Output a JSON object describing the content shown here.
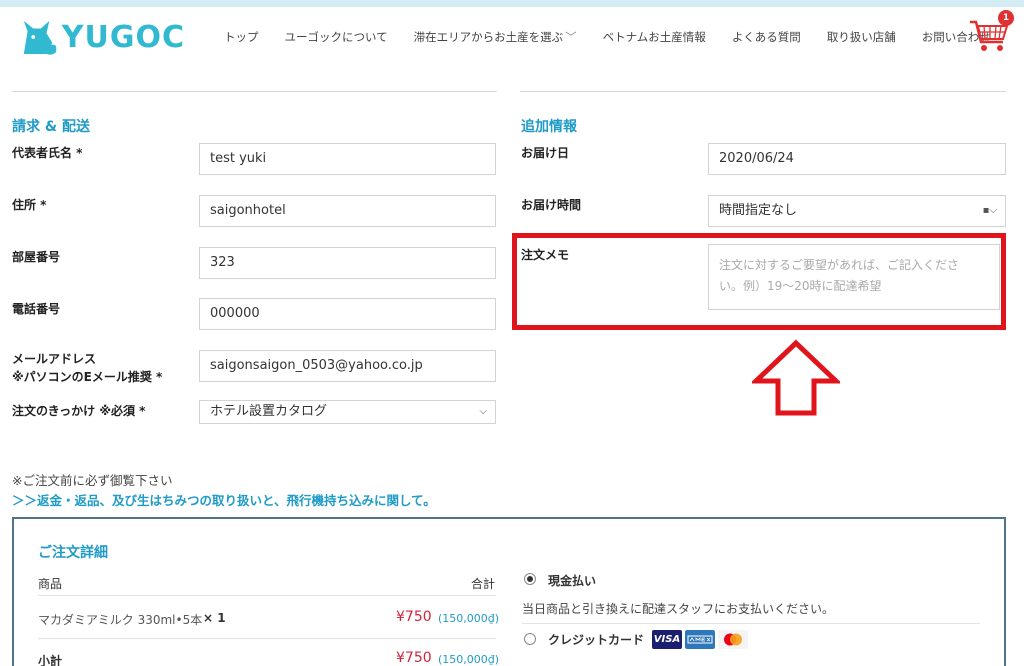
{
  "brand": {
    "name": "YUGOC"
  },
  "nav": {
    "items": [
      "トップ",
      "ユーゴックについて",
      "滞在エリアからお土産を選ぶ",
      "ベトナムお土産情報",
      "よくある質問",
      "取り扱い店舗",
      "お問い合わせ"
    ]
  },
  "cart": {
    "count": "1"
  },
  "billing": {
    "title": "請求 & 配送",
    "name_label": "代表者氏名 *",
    "name_value": "test yuki",
    "address_label": "住所 *",
    "address_value": "saigonhotel",
    "room_label": "部屋番号",
    "room_value": "323",
    "phone_label": "電話番号",
    "phone_value": "000000",
    "email_label_1": "メールアドレス",
    "email_label_2": "※パソコンのEメール推奨 *",
    "email_value": "saigonsaigon_0503@yahoo.co.jp",
    "source_label": "注文のきっかけ ※必須 *",
    "source_value": "ホテル設置カタログ"
  },
  "additional": {
    "title": "追加情報",
    "date_label": "お届け日",
    "date_value": "2020/06/24",
    "time_label": "お届け時間",
    "time_value": "時間指定なし",
    "memo_label": "注文メモ",
    "memo_placeholder_1": "注文に対するご要望があれば、ご記入くださ",
    "memo_placeholder_2": "い。例）19～20時に配達希望"
  },
  "notice": {
    "text": "※ご注文前に必ず御覧下さい",
    "link": "＞＞返金・返品、及び生はちみつの取り扱いと、飛行機持ち込みに関して。"
  },
  "order": {
    "title": "ご注文詳細",
    "col_product": "商品",
    "col_total": "合計",
    "item_name": "マカダミアミルク 330ml•5本",
    "item_qty": "× 1",
    "item_price": "¥750",
    "item_price_vnd": "(150,000₫)",
    "subtotal_label": "小計",
    "subtotal_price": "¥750",
    "subtotal_vnd": "(150,000₫)"
  },
  "payment": {
    "cash_label": "現金払い",
    "cash_desc": "当日商品と引き換えに配達スタッフにお支払いください。",
    "card_label": "クレジットカード",
    "visa": "VISA"
  },
  "colors": {
    "accent": "#1f9bc7",
    "highlight": "#e0151c",
    "price": "#d0243a"
  }
}
